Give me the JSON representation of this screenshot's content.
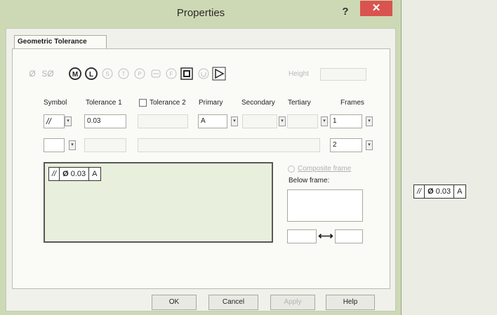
{
  "window": {
    "title": "Properties",
    "help_glyph": "?",
    "close_glyph": "✕"
  },
  "tabs": [
    {
      "label": "Geometric Tolerance"
    }
  ],
  "symbols": {
    "diameter": "Ø",
    "sd": "SØ",
    "modifiers": [
      "M",
      "L",
      "S",
      "T",
      "P",
      "F"
    ],
    "height_label": "Height"
  },
  "columns": {
    "symbol": "Symbol",
    "tolerance1": "Tolerance 1",
    "tolerance2": "Tolerance 2",
    "primary": "Primary",
    "secondary": "Secondary",
    "tertiary": "Tertiary",
    "frames": "Frames"
  },
  "row1": {
    "symbol": "//",
    "tolerance1": "0.03",
    "primary": "A",
    "frames": "1"
  },
  "row2": {
    "frames": "2"
  },
  "preview": {
    "symbol": "//",
    "diameter": "Ø",
    "tolerance": "0.03",
    "datum": "A"
  },
  "composite": {
    "label": "Composite frame",
    "below_label": "Below frame:",
    "arrows": "⟷"
  },
  "buttons": {
    "ok": "OK",
    "cancel": "Cancel",
    "apply": "Apply",
    "help": "Help"
  },
  "side_preview": {
    "symbol": "//",
    "diameter": "Ø",
    "tolerance": "0.03",
    "datum": "A"
  }
}
